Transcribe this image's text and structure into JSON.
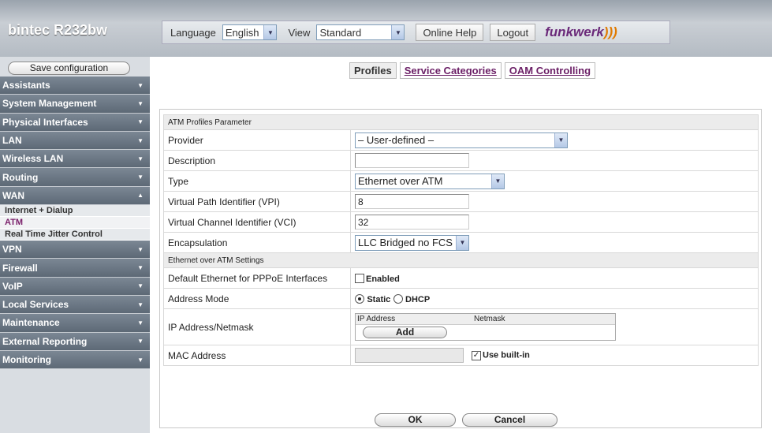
{
  "header": {
    "brand": "bintec R232bw",
    "language_label": "Language",
    "language_value": "English",
    "view_label": "View",
    "view_value": "Standard",
    "online_help": "Online Help",
    "logout": "Logout",
    "logo_text": "funkwerk",
    "logo_wave": ")))"
  },
  "sidebar": {
    "save_configuration": "Save configuration",
    "menu_top": [
      {
        "label": "Assistants"
      },
      {
        "label": "System Management"
      },
      {
        "label": "Physical Interfaces"
      },
      {
        "label": "LAN"
      },
      {
        "label": "Wireless LAN"
      },
      {
        "label": "Routing"
      },
      {
        "label": "WAN"
      }
    ],
    "wan_items": [
      {
        "label": "Internet + Dialup"
      },
      {
        "label": "ATM"
      },
      {
        "label": "Real Time Jitter Control"
      }
    ],
    "menu_bottom": [
      {
        "label": "VPN"
      },
      {
        "label": "Firewall"
      },
      {
        "label": "VoIP"
      },
      {
        "label": "Local Services"
      },
      {
        "label": "Maintenance"
      },
      {
        "label": "External Reporting"
      },
      {
        "label": "Monitoring"
      }
    ]
  },
  "tabs": {
    "profiles": "Profiles",
    "service_categories": "Service Categories",
    "oam_controlling": "OAM Controlling"
  },
  "form": {
    "section1": "ATM Profiles Parameter",
    "provider_label": "Provider",
    "provider_value": "– User-defined –",
    "description_label": "Description",
    "description_value": "",
    "type_label": "Type",
    "type_value": "Ethernet over ATM",
    "vpi_label": "Virtual Path Identifier (VPI)",
    "vpi_value": "8",
    "vci_label": "Virtual Channel Identifier (VCI)",
    "vci_value": "32",
    "encap_label": "Encapsulation",
    "encap_value": "LLC Bridged no FCS",
    "section2": "Ethernet over ATM Settings",
    "pppoe_label": "Default Ethernet for PPPoE Interfaces",
    "pppoe_enabled": "Enabled",
    "address_mode_label": "Address Mode",
    "static_label": "Static",
    "dhcp_label": "DHCP",
    "ip_label": "IP Address/Netmask",
    "ip_col": "IP Address",
    "netmask_col": "Netmask",
    "add": "Add",
    "mac_label": "MAC Address",
    "use_builtin": "Use built-in"
  },
  "buttons": {
    "ok": "OK",
    "cancel": "Cancel"
  }
}
